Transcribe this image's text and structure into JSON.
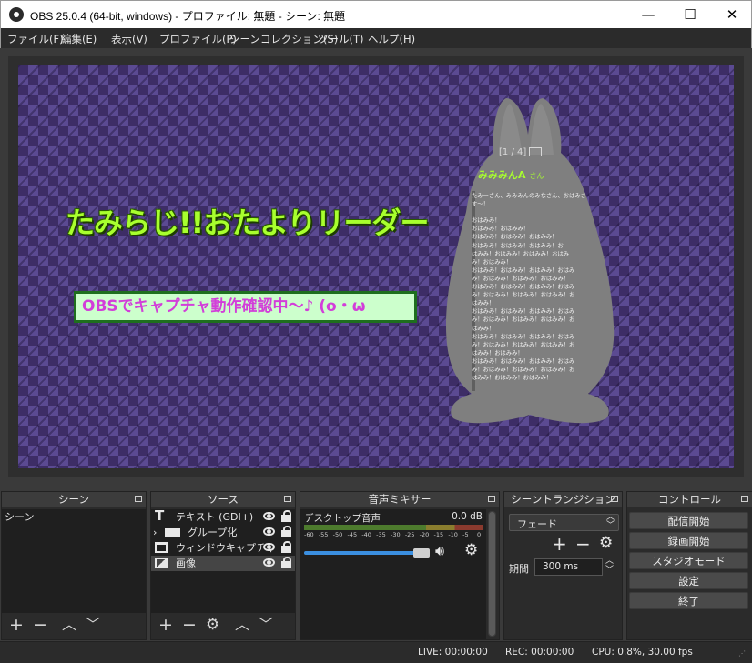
{
  "window": {
    "title": "OBS 25.0.4 (64-bit, windows) - プロファイル: 無題 - シーン: 無題",
    "minimize": "—",
    "maximize": "☐",
    "close": "✕"
  },
  "menu": [
    "ファイル(F)",
    "編集(E)",
    "表示(V)",
    "プロファイル(P)",
    "シーンコレクション(S)",
    "ツール(T)",
    "ヘルプ(H)"
  ],
  "preview": {
    "headline": "たみらじ!!おたよりリーダー",
    "caption": "OBSでキャプチャ動作確認中～♪ (o・ω",
    "chat": {
      "page": "[1 / 4]",
      "author": "みみみんA",
      "author_suffix": "さん",
      "lines": [
        "たみーさん、みみみんのみなさん、おはみさ",
        "す～！",
        "",
        "おはみみ！",
        "おはみみ！おはみみ！",
        "おはみみ！おはみみ！おはみみ！",
        "おはみみ！おはみみ！おはみみ！お",
        "はみみ！おはみみ！おはみみ！おはみ",
        "み！おはみみ！",
        "おはみみ！おはみみ！おはみみ！おはみ",
        "み！おはみみ！おはみみ！おはみみ！",
        "おはみみ！おはみみ！おはみみ！おはみ",
        "み！おはみみ！おはみみ！おはみみ！お",
        "はみみ！",
        "おはみみ！おはみみ！おはみみ！おはみ",
        "み！おはみみ！おはみみ！おはみみ！お",
        "はみみ！",
        "おはみみ！おはみみ！おはみみ！おはみ",
        "み！おはみみ！おはみみ！おはみみ！お",
        "はみみ！おはみみ！",
        "おはみみ！おはみみ！おはみみ！おはみ",
        "み！おはみみ！おはみみ！おはみみ！お",
        "はみみ！おはみみ！おはみみ！"
      ]
    }
  },
  "docks": {
    "scenes": {
      "title": "シーン",
      "items": [
        "シーン"
      ]
    },
    "sources": {
      "title": "ソース",
      "items": [
        {
          "name": "テキスト (GDI+)",
          "icon": "text-icon"
        },
        {
          "name": "グループ化",
          "icon": "folder-icon"
        },
        {
          "name": "ウィンドウキャプチャ",
          "icon": "window-icon"
        },
        {
          "name": "画像",
          "icon": "image-icon"
        }
      ]
    },
    "mixer": {
      "title": "音声ミキサー",
      "channel": "デスクトップ音声",
      "level": "0.0 dB",
      "ticks": [
        "-60",
        "-55",
        "-50",
        "-45",
        "-40",
        "-35",
        "-30",
        "-25",
        "-20",
        "-15",
        "-10",
        "-5",
        "0"
      ],
      "volume": 0.92
    },
    "transitions": {
      "title": "シーントランジション",
      "selected": "フェード",
      "duration_label": "期間",
      "duration": "300 ms"
    },
    "controls": {
      "title": "コントロール",
      "buttons": [
        "配信開始",
        "録画開始",
        "スタジオモード",
        "設定",
        "終了"
      ]
    }
  },
  "status": {
    "live": "LIVE: 00:00:00",
    "rec": "REC: 00:00:00",
    "cpu": "CPU: 0.8%, 30.00 fps"
  },
  "colors": {
    "headline": "#a8ff2e",
    "caption_text": "#d23ed9",
    "caption_bg": "#ccffcc",
    "canvas_dark": "#3d2d66",
    "canvas_light": "#5b4a92"
  }
}
